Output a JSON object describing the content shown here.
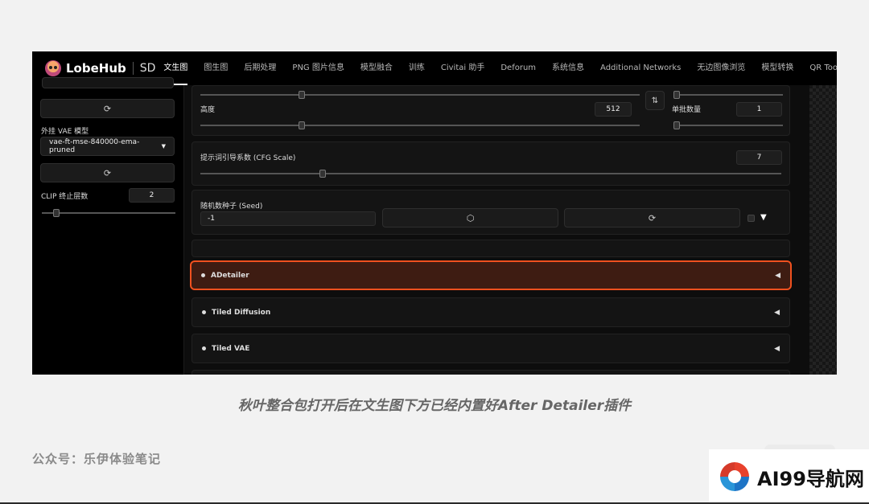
{
  "app": {
    "logo_name": "LobeHub",
    "logo_suffix": "SD"
  },
  "nav": {
    "tabs": [
      "文生图",
      "图生图",
      "后期处理",
      "PNG 图片信息",
      "模型融合",
      "训练",
      "Civitai 助手",
      "Deforum",
      "系统信息",
      "Additional Networks",
      "无边图像浏览",
      "模型转换",
      "QR Toolkit"
    ],
    "active": "文生图"
  },
  "left": {
    "refresh_icon": "refresh-icon",
    "vae_label": "外挂 VAE 模型",
    "vae_value": "vae-ft-mse-840000-ema-pruned",
    "clip_label": "CLIP 终止层数",
    "clip_value": "2",
    "clip_slider_fraction": 0.1
  },
  "main": {
    "height_label": "高度",
    "height_value": "512",
    "swap_icon": "swap-icon",
    "batch_size_label": "单批数量",
    "batch_size_value": "1",
    "cfg_label": "提示词引导系数 (CFG Scale)",
    "cfg_value": "7",
    "seed_label": "随机数种子 (Seed)",
    "seed_value": "-1",
    "dice_icon": "dice-icon",
    "recycle_icon": "recycle-icon",
    "extra_toggle": "▼"
  },
  "accordions": [
    {
      "label": "ADetailer",
      "highlighted": true,
      "arrow": "◀"
    },
    {
      "label": "Tiled Diffusion",
      "highlighted": false,
      "arrow": "◀"
    },
    {
      "label": "Tiled VAE",
      "highlighted": false,
      "arrow": "◀"
    }
  ],
  "caption": "秋叶整合包打开后在文生图下方已经内置好After Detailer插件",
  "account": "公众号：乐伊体验笔记",
  "watermark": {
    "text": "AI99导航网"
  },
  "colors": {
    "highlight_border": "#f0511f",
    "highlight_bg": "#3e1c12",
    "panel": "#141414"
  }
}
